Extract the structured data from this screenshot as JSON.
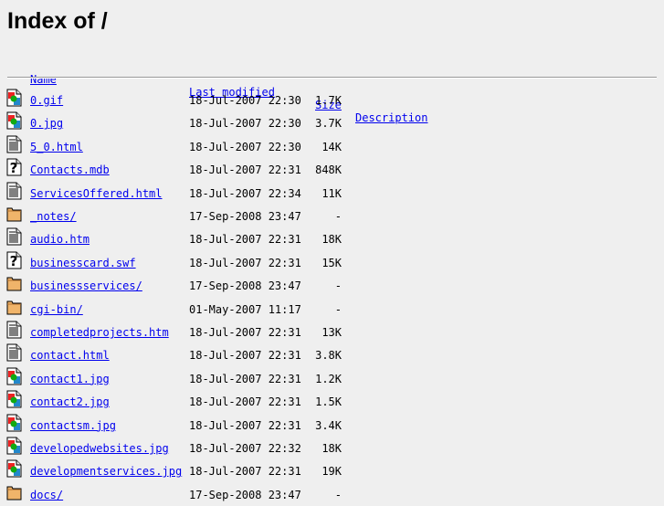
{
  "title": "Index of /",
  "headers": {
    "name": "Name",
    "modified": "Last modified",
    "size": "Size",
    "description": "Description"
  },
  "files": [
    {
      "icon": "image",
      "name": "0.gif",
      "modified": "18-Jul-2007 22:30",
      "size": "1.7K"
    },
    {
      "icon": "image",
      "name": "0.jpg",
      "modified": "18-Jul-2007 22:30",
      "size": "3.7K"
    },
    {
      "icon": "text",
      "name": "5_0.html",
      "modified": "18-Jul-2007 22:30",
      "size": "14K"
    },
    {
      "icon": "unknown",
      "name": "Contacts.mdb",
      "modified": "18-Jul-2007 22:31",
      "size": "848K"
    },
    {
      "icon": "text",
      "name": "ServicesOffered.html",
      "modified": "18-Jul-2007 22:34",
      "size": "11K"
    },
    {
      "icon": "folder",
      "name": "_notes/",
      "modified": "17-Sep-2008 23:47",
      "size": "-"
    },
    {
      "icon": "text",
      "name": "audio.htm",
      "modified": "18-Jul-2007 22:31",
      "size": "18K"
    },
    {
      "icon": "unknown",
      "name": "businesscard.swf",
      "modified": "18-Jul-2007 22:31",
      "size": "15K"
    },
    {
      "icon": "folder",
      "name": "businessservices/",
      "modified": "17-Sep-2008 23:47",
      "size": "-"
    },
    {
      "icon": "folder",
      "name": "cgi-bin/",
      "modified": "01-May-2007 11:17",
      "size": "-"
    },
    {
      "icon": "text",
      "name": "completedprojects.htm",
      "modified": "18-Jul-2007 22:31",
      "size": "13K"
    },
    {
      "icon": "text",
      "name": "contact.html",
      "modified": "18-Jul-2007 22:31",
      "size": "3.8K"
    },
    {
      "icon": "image",
      "name": "contact1.jpg",
      "modified": "18-Jul-2007 22:31",
      "size": "1.2K"
    },
    {
      "icon": "image",
      "name": "contact2.jpg",
      "modified": "18-Jul-2007 22:31",
      "size": "1.5K"
    },
    {
      "icon": "image",
      "name": "contactsm.jpg",
      "modified": "18-Jul-2007 22:31",
      "size": "3.4K"
    },
    {
      "icon": "image",
      "name": "developedwebsites.jpg",
      "modified": "18-Jul-2007 22:32",
      "size": "18K"
    },
    {
      "icon": "image",
      "name": "developmentservices.jpg",
      "modified": "18-Jul-2007 22:31",
      "size": "19K"
    },
    {
      "icon": "folder",
      "name": "docs/",
      "modified": "17-Sep-2008 23:47",
      "size": "-"
    }
  ]
}
